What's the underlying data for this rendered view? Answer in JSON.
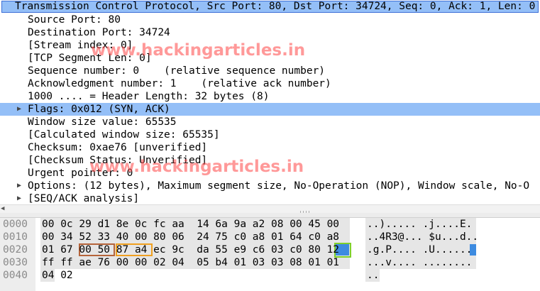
{
  "packet_details": {
    "header": "Transmission Control Protocol, Src Port: 80, Dst Port: 34724, Seq: 0, Ack: 1, Len: 0",
    "fields": [
      "Source Port: 80",
      "Destination Port: 34724",
      "[Stream index: 0]",
      "[TCP Segment Len: 0]",
      "Sequence number: 0    (relative sequence number)",
      "Acknowledgment number: 1    (relative ack number)",
      "1000 .... = Header Length: 32 bytes (8)",
      "Flags: 0x012 (SYN, ACK)",
      "Window size value: 65535",
      "[Calculated window size: 65535]",
      "Checksum: 0xae76 [unverified]",
      "[Checksum Status: Unverified]",
      "Urgent pointer: 0",
      "Options: (12 bytes), Maximum segment size, No-Operation (NOP), Window scale, No-O",
      "[SEQ/ACK analysis]"
    ],
    "expander_glyph": "▶"
  },
  "watermark": "www.hackingarticles.in",
  "bytes_pane": {
    "offsets": [
      "0000",
      "0010",
      "0020",
      "0030",
      "0040"
    ],
    "hex": [
      "00 0c 29 d1 8e 0c fc aa  14 6a 9a a2 08 00 45 00",
      "00 34 52 33 40 00 80 06  24 75 c0 a8 01 64 c0 a8",
      "01 67 00 50 87 a4 ec 9c  da 55 e9 c6 03 c0 80 12",
      "ff ff ae 76 00 00 02 04  05 b4 01 03 03 08 01 01",
      "04 02"
    ],
    "ascii": [
      "..)..... .j....E.",
      "..4R3@... $u...d..",
      ".g.P.... .U......",
      "...v.... ........",
      ".."
    ],
    "highlight_colors": {
      "src_port": "#b5643a",
      "dst_port": "#f0a020",
      "flags": "#7fd02a",
      "selected": "#3d8be0"
    }
  }
}
